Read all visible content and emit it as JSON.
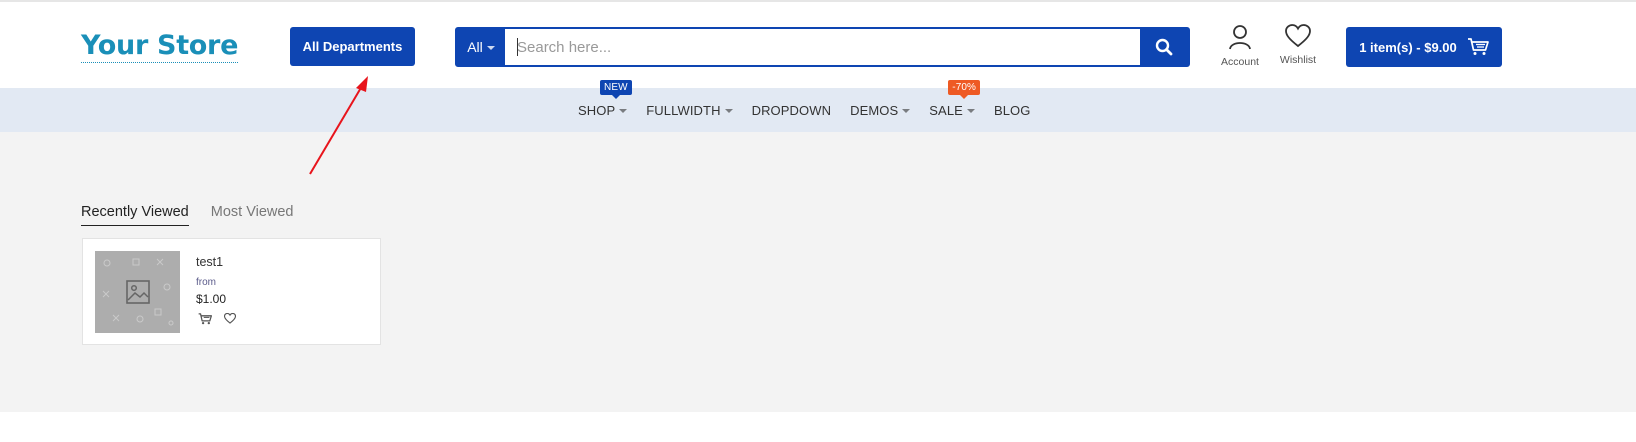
{
  "header": {
    "logo": "Your Store",
    "departments_label": "All Departments",
    "search": {
      "category": "All",
      "placeholder": "Search here..."
    },
    "account_label": "Account",
    "wishlist_label": "Wishlist",
    "cart_label": "1 item(s) - $9.00"
  },
  "nav": {
    "items": [
      {
        "label": "SHOP",
        "dropdown": true,
        "badge": "NEW"
      },
      {
        "label": "FULLWIDTH",
        "dropdown": true
      },
      {
        "label": "DROPDOWN",
        "dropdown": false
      },
      {
        "label": "DEMOS",
        "dropdown": true
      },
      {
        "label": "SALE",
        "dropdown": true,
        "badge": "-70%"
      },
      {
        "label": "BLOG",
        "dropdown": false
      }
    ]
  },
  "tabs": [
    {
      "label": "Recently Viewed",
      "active": true
    },
    {
      "label": "Most Viewed",
      "active": false
    }
  ],
  "product": {
    "name": "test1",
    "price_prefix": "from",
    "price": "$1.00",
    "image_icon": "image-placeholder-icon"
  },
  "colors": {
    "primary": "#0e45b2",
    "logo": "#1a8fb8",
    "sale_badge": "#ee5a24",
    "nav_bg": "#e2e9f3",
    "annotation": "#e8141c"
  }
}
